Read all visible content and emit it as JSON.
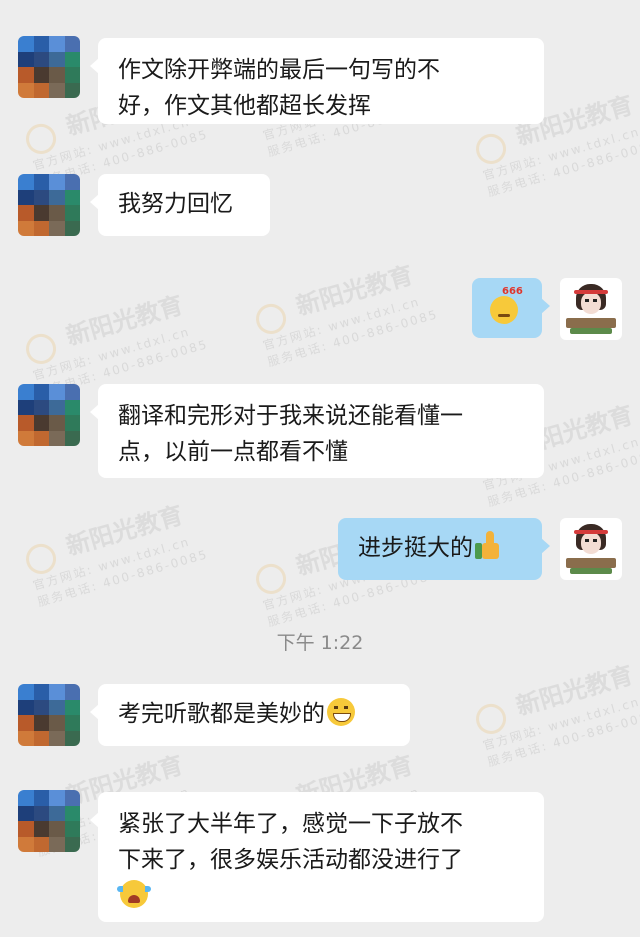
{
  "watermark": {
    "brand": "新阳光教育",
    "site": "官方网站: www.tdxl.cn",
    "phone": "服务电话: 400-886-0085"
  },
  "messages": [
    {
      "side": "left",
      "lines": [
        "作文除开弊端的最后一句写的不",
        "好，作文其他都超长发挥"
      ]
    },
    {
      "side": "left",
      "lines": [
        "我努力回忆"
      ]
    },
    {
      "side": "right",
      "sticker": "666"
    },
    {
      "side": "left",
      "lines": [
        "翻译和完形对于我来说还能看懂一",
        "点，以前一点都看不懂"
      ]
    },
    {
      "side": "right",
      "lines": [
        "进步挺大的"
      ],
      "icon": "thumbs-up"
    },
    {
      "side": "left",
      "lines": [
        "考完听歌都是美妙的"
      ],
      "icon": "grin"
    },
    {
      "side": "left",
      "lines": [
        "紧张了大半年了，感觉一下子放不",
        "下来了，很多娱乐活动都没进行了"
      ],
      "icon": "cry"
    }
  ],
  "timestamp": "下午 1:22",
  "sticker_text": "666",
  "colors": {
    "background": "#ededed",
    "bubble_other": "#ffffff",
    "bubble_self": "#a7d8f5"
  }
}
